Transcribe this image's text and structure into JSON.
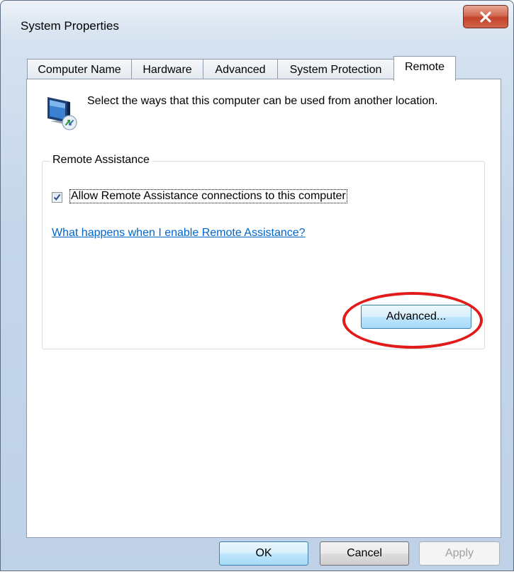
{
  "window": {
    "title": "System Properties",
    "close_label": "x"
  },
  "tabs": [
    {
      "label": "Computer Name",
      "active": false
    },
    {
      "label": "Hardware",
      "active": false
    },
    {
      "label": "Advanced",
      "active": false
    },
    {
      "label": "System Protection",
      "active": false
    },
    {
      "label": "Remote",
      "active": true
    }
  ],
  "panel": {
    "intro_text": "Select the ways that this computer can be used from another location.",
    "icon": "remote-monitor-icon",
    "remote_assistance": {
      "group_label": "Remote Assistance",
      "checkbox_checked": true,
      "checkbox_label": "Allow Remote Assistance connections to this computer",
      "help_link": "What happens when I enable Remote Assistance?",
      "advanced_button": "Advanced..."
    }
  },
  "footer": {
    "ok": "OK",
    "cancel": "Cancel",
    "apply": "Apply",
    "apply_enabled": false
  },
  "annotation": {
    "highlight_color": "#e11a1a"
  }
}
